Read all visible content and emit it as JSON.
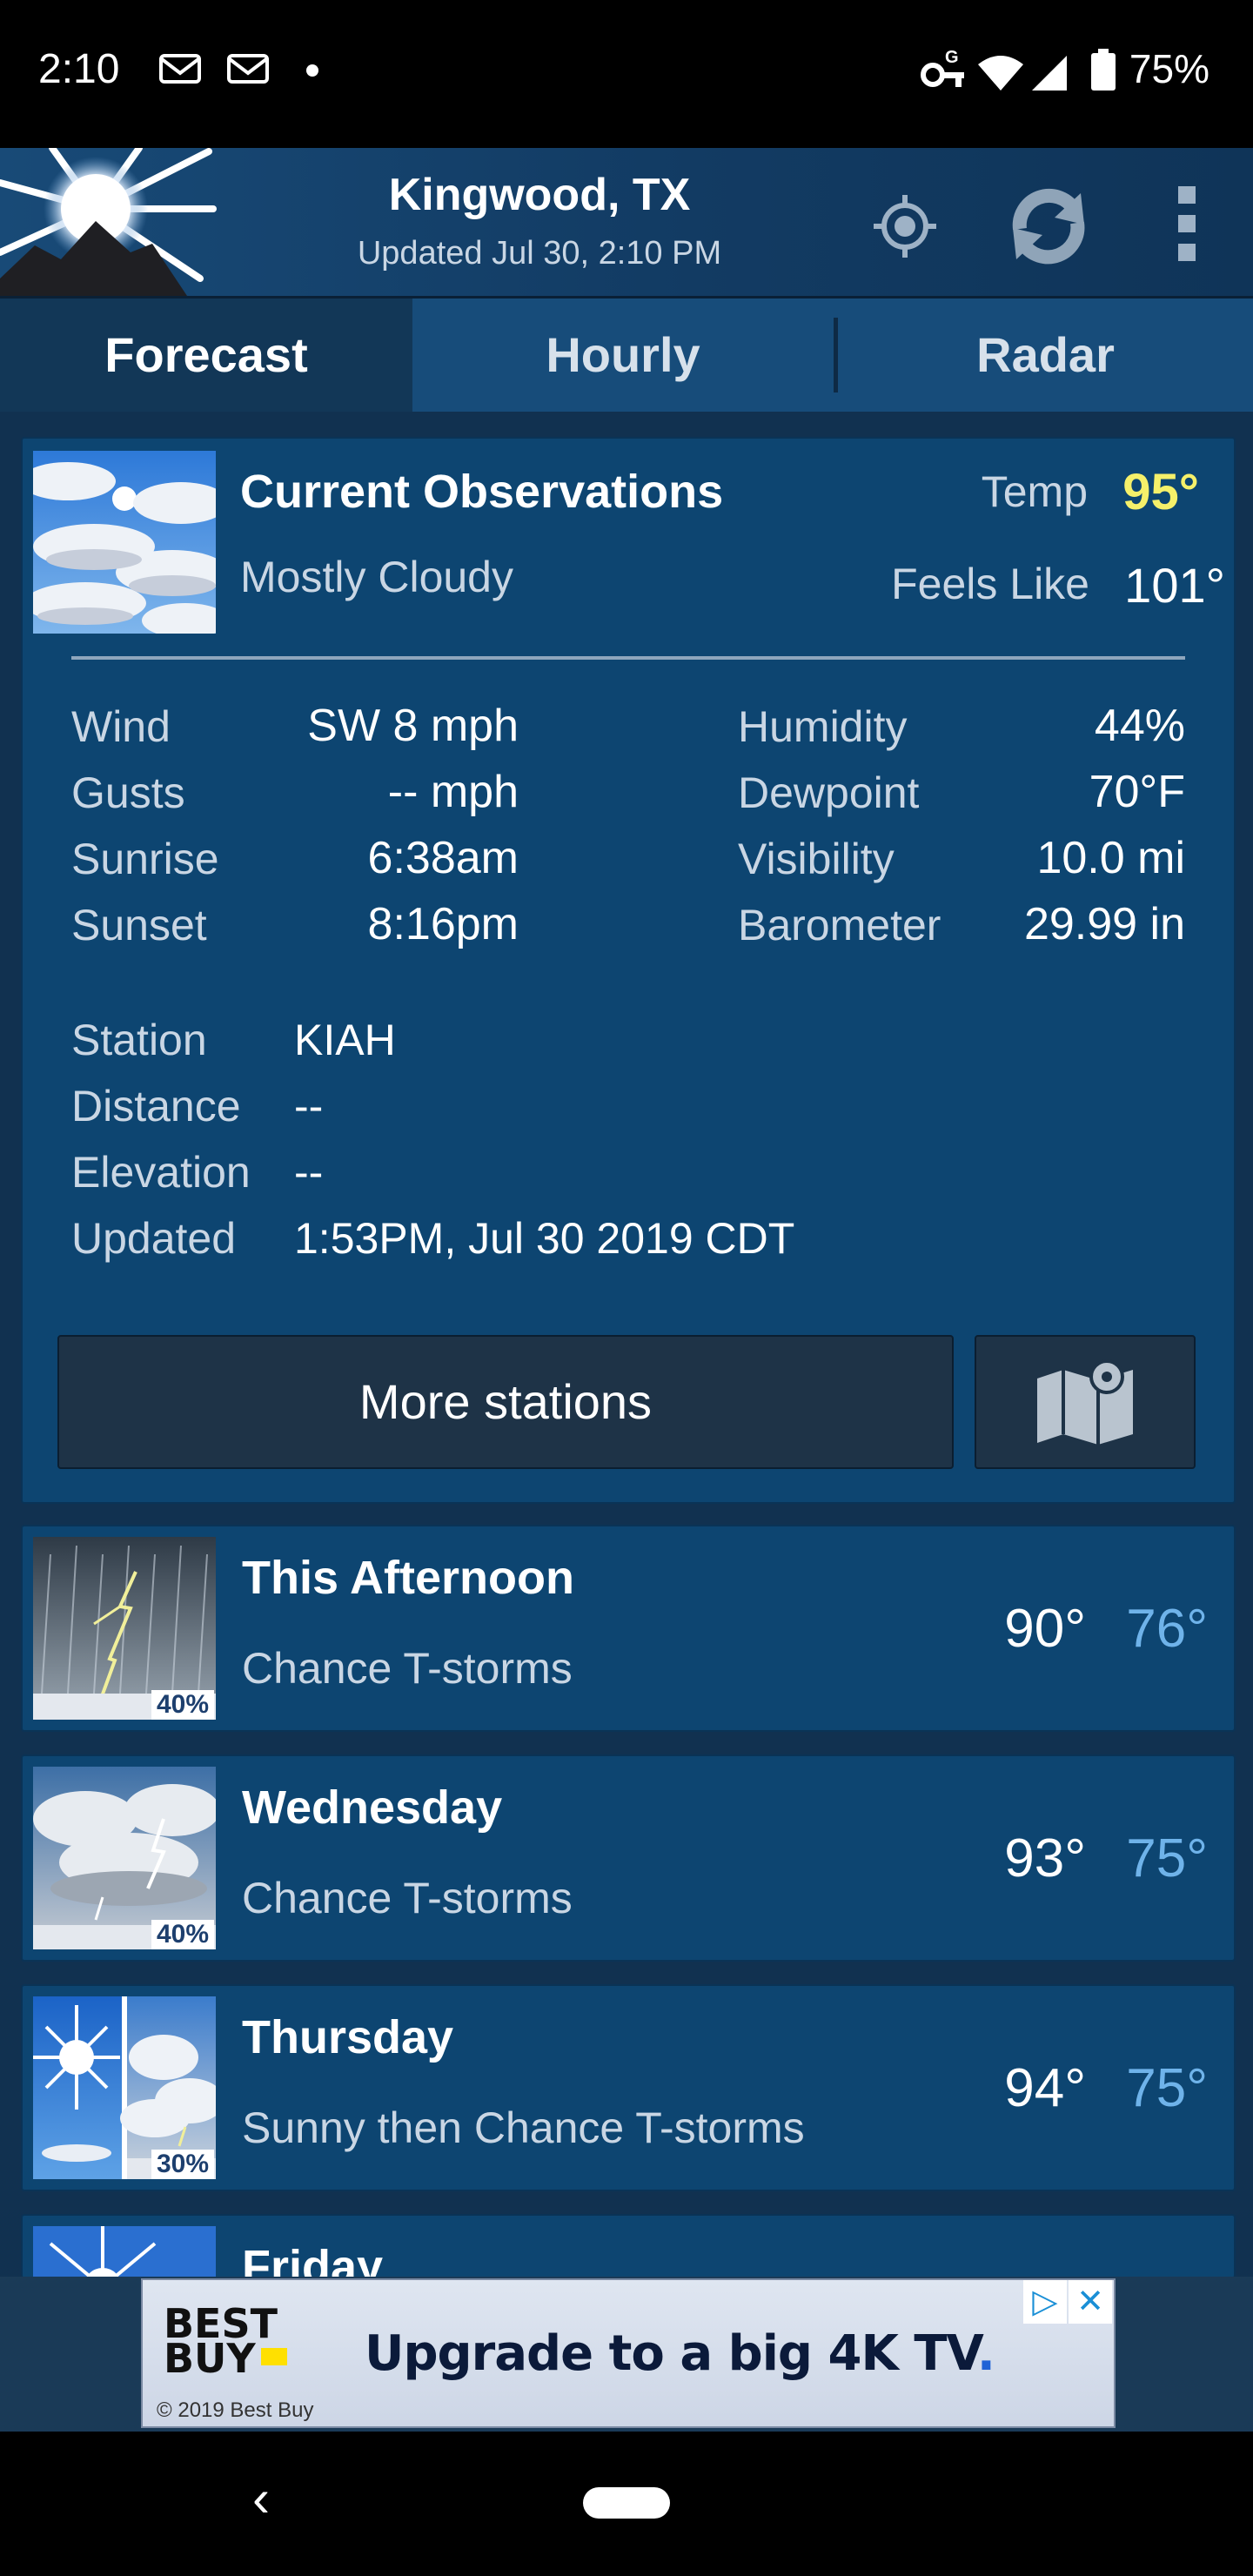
{
  "status_bar": {
    "time": "2:10",
    "battery": "75%"
  },
  "header": {
    "location": "Kingwood, TX",
    "updated": "Updated Jul 30, 2:10 PM"
  },
  "tabs": [
    "Forecast",
    "Hourly",
    "Radar"
  ],
  "current": {
    "title": "Current Observations",
    "condition": "Mostly Cloudy",
    "temp_label": "Temp",
    "temp": "95°",
    "feels_label": "Feels Like",
    "feels": "101°",
    "left_stats": [
      {
        "label": "Wind",
        "value": "SW 8 mph"
      },
      {
        "label": "Gusts",
        "value": "-- mph"
      },
      {
        "label": "Sunrise",
        "value": "6:38am"
      },
      {
        "label": "Sunset",
        "value": "8:16pm"
      }
    ],
    "right_stats": [
      {
        "label": "Humidity",
        "value": "44%"
      },
      {
        "label": "Dewpoint",
        "value": "70°F"
      },
      {
        "label": "Visibility",
        "value": "10.0 mi"
      },
      {
        "label": "Barometer",
        "value": "29.99 in"
      }
    ],
    "station": [
      {
        "label": "Station",
        "value": "KIAH"
      },
      {
        "label": "Distance",
        "value": "--"
      },
      {
        "label": "Elevation",
        "value": "--"
      },
      {
        "label": "Updated",
        "value": "1:53PM, Jul 30 2019 CDT"
      }
    ],
    "more_stations": "More stations"
  },
  "forecast": [
    {
      "day": "This Afternoon",
      "condition": "Chance T-storms",
      "hi": "90°",
      "lo": "76°",
      "pop": "40%"
    },
    {
      "day": "Wednesday",
      "condition": "Chance T-storms",
      "hi": "93°",
      "lo": "75°",
      "pop": "40%"
    },
    {
      "day": "Thursday",
      "condition": "Sunny then Chance T-storms",
      "hi": "94°",
      "lo": "75°",
      "pop": "30%"
    },
    {
      "day": "Friday"
    }
  ],
  "ad": {
    "brand_line1": "BEST",
    "brand_line2": "BUY",
    "copy": "Upgrade to a big 4K TV",
    "copy_dot": ".",
    "footer": "© 2019 Best Buy"
  },
  "colors": {
    "background": "#113150",
    "card": "#0d4571",
    "temp_highlight": "#f5f06a",
    "low_temp": "#6fb3ea"
  }
}
